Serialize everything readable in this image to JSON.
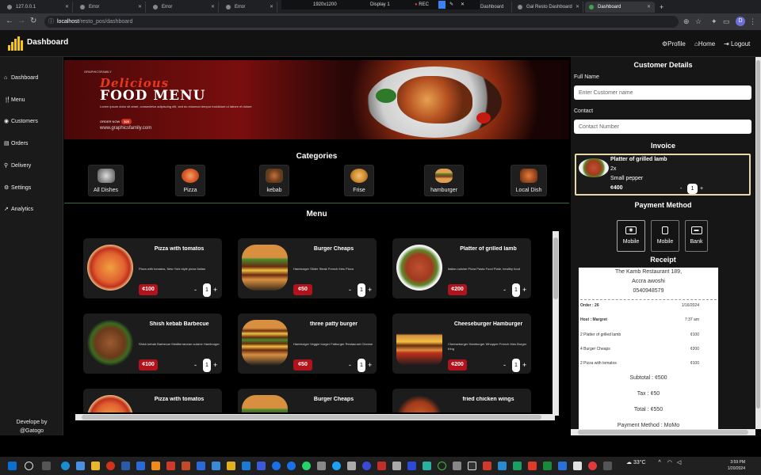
{
  "browser": {
    "tabs": [
      {
        "title": "127.0.0.1"
      },
      {
        "title": "Error"
      },
      {
        "title": "Error"
      },
      {
        "title": "Error"
      },
      {
        "title": "Dashboard"
      },
      {
        "title": "Gal Resto Dashboard"
      },
      {
        "title": "Dashboard"
      }
    ],
    "recorder": {
      "resolution": "1920x1200",
      "display": "Display 1",
      "rec_label": "REC"
    },
    "url_host": "localhost",
    "url_path": "/resto_pos/dashboard",
    "profile_initial": "D"
  },
  "header": {
    "brand": "Dashboard",
    "links": [
      {
        "label": "Profile",
        "icon": "gear-icon"
      },
      {
        "label": "Home",
        "icon": "home-icon"
      },
      {
        "label": "Logout",
        "icon": "logout-icon"
      }
    ]
  },
  "sidebar": {
    "items": [
      {
        "label": "Dashboard",
        "icon": "home-icon"
      },
      {
        "label": "Menu",
        "icon": "utensils-icon"
      },
      {
        "label": "Customers",
        "icon": "eye-icon"
      },
      {
        "label": "Orders",
        "icon": "receipt-icon"
      },
      {
        "label": "Delivery",
        "icon": "motorcycle-icon"
      },
      {
        "label": "Settings",
        "icon": "cogs-icon"
      },
      {
        "label": "Analytics",
        "icon": "chart-line-icon"
      }
    ],
    "credit_line1": "Develope by",
    "credit_line2": "@Gatogo"
  },
  "banner": {
    "small": "GRAPHICSFAMILY",
    "line1": "Delicious",
    "line2": "FOOD MENU",
    "body": "Lorem ipsum dolor sit amet, consectetur adipiscing elit, sed do eiusmod tempor incididunt ut labore et dolore",
    "order_label": "ORDER NOW",
    "order_badge": "$20",
    "website": "www.graphicsfamily.com"
  },
  "categories": {
    "title": "Categories",
    "items": [
      {
        "label": "All Dishes"
      },
      {
        "label": "Pizza"
      },
      {
        "label": "kebab"
      },
      {
        "label": "Frise"
      },
      {
        "label": "hamburger"
      },
      {
        "label": "Local Dish"
      }
    ]
  },
  "menu": {
    "title": "Menu",
    "items": [
      {
        "name": "Pizza with tomatos",
        "desc": "Pizza with tomatos, New York style pizza Italian",
        "price": "¢100",
        "qty": "1"
      },
      {
        "name": "Burger Cheaps",
        "desc": "Hamburger Slider Steak French fries Pizza",
        "price": "¢50",
        "qty": "1"
      },
      {
        "name": "Platter of grilled lamb",
        "desc": "Italian cuisine Pizza Pasta Food Plate, healthy food",
        "price": "¢200",
        "qty": "1"
      },
      {
        "name": "Shish kebab Barbecue",
        "desc": "Shish kebab Barbecue Mediterranean cuisine Hamburger",
        "price": "¢100",
        "qty": "1"
      },
      {
        "name": "three patty burger",
        "desc": "Hamburger Veggie burger Fatburger Restaurant Cheese",
        "price": "¢50",
        "qty": "1"
      },
      {
        "name": "Cheeseburger Hamburger",
        "desc": "Cheeseburger Hamburger Whopper French fries Burger King",
        "price": "¢200",
        "qty": "1"
      },
      {
        "name": "Pizza with tomatos",
        "desc": "",
        "price": "",
        "qty": ""
      },
      {
        "name": "Burger Cheaps",
        "desc": "",
        "price": "",
        "qty": ""
      },
      {
        "name": "fried chicken wings",
        "desc": "",
        "price": "",
        "qty": ""
      }
    ]
  },
  "customer": {
    "title": "Customer Details",
    "name_label": "Full Name",
    "name_placeholder": "Enter Customer name",
    "contact_label": "Contact",
    "contact_placeholder": "Contact Number"
  },
  "invoice": {
    "title": "Invoice",
    "item_name": "Platter of grilled lamb",
    "item_qty": "2x",
    "item_note": "Small pepper",
    "item_price": "¢400",
    "item_count": "1"
  },
  "payment": {
    "title": "Payment Method",
    "options": [
      {
        "label": "Mobile"
      },
      {
        "label": "Mobile"
      },
      {
        "label": "Bank"
      }
    ]
  },
  "receipt": {
    "title": "Receipt",
    "line1": "The Kamb Restaurant 189,",
    "line2": "Accra awoshi",
    "line3": "0540948579",
    "order": "Order : 26",
    "date": "1/16/2024",
    "host": "Host : Margret",
    "time": "7:37 am",
    "lines": [
      {
        "desc": "2 Platter of grilled lamb",
        "amount": "¢100"
      },
      {
        "desc": "4 Burger Cheaps",
        "amount": "¢200"
      },
      {
        "desc": "2 Pizza with tomatos",
        "amount": "¢100"
      }
    ],
    "subtotal": "Subtotal : ¢500",
    "tax": "Tax : ¢50",
    "total": "Total : ¢550",
    "method": "Payment Method : MoMo"
  },
  "taskbar": {
    "weather": "33°C",
    "time": "3:59 PM",
    "date": "1/20/2024"
  },
  "colors": {
    "accent_gold": "#f5c518",
    "price_red": "#b1121c",
    "invoice_border": "#e9d9a8",
    "panel_bg": "#161616"
  }
}
